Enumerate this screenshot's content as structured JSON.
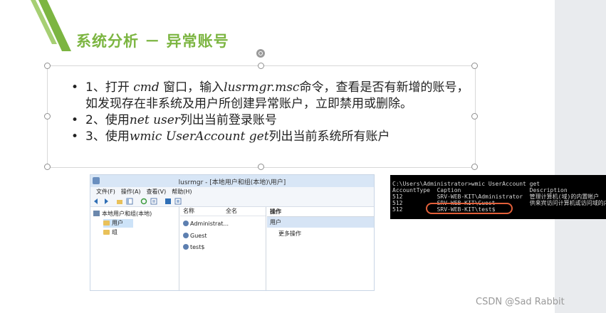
{
  "slide": {
    "title": "系统分析 － 异常账号",
    "bullets": [
      {
        "prefix": "1、打开 ",
        "code1": "cmd",
        "mid1": " 窗口，输入",
        "code2": "lusrmgr.msc",
        "rest": "命令，查看是否有新增的账号，如发现存在非系统及用户所创建异常账户，立即禁用或删除。"
      },
      {
        "prefix": "2、使用",
        "code1": "net user",
        "rest": "列出当前登录账号"
      },
      {
        "prefix": "3、使用",
        "code1": "wmic UserAccount get",
        "rest": "列出当前系统所有账户"
      }
    ]
  },
  "lusrmgr": {
    "title": "lusrmgr - [本地用户和组(本地)\\用户]",
    "menu": [
      "文件(F)",
      "操作(A)",
      "查看(V)",
      "帮助(H)"
    ],
    "tree": {
      "root": "本地用户和组(本地)",
      "users": "用户",
      "groups": "组"
    },
    "columns": [
      "名称",
      "全名"
    ],
    "users": [
      "Administrat...",
      "Guest",
      "test$"
    ],
    "actions": {
      "header": "操作",
      "section": "用户",
      "more": "更多操作"
    }
  },
  "cmd": {
    "lines": [
      "C:\\Users\\Administrator>wmic UserAccount get",
      "AccountType  Caption                    Description",
      "512          SRV-WEB-KIT\\Administrator  管理计算机(域)的内置帐户",
      "512          SRV-WEB-KIT\\Guest          供来宾访问计算机或访问域的内",
      "512          SRV-WEB-KIT\\test$"
    ]
  },
  "watermark": "CSDN @Sad Rabbit",
  "colors": {
    "accent_green": "#7cb541",
    "highlight_red": "#e2603a"
  }
}
